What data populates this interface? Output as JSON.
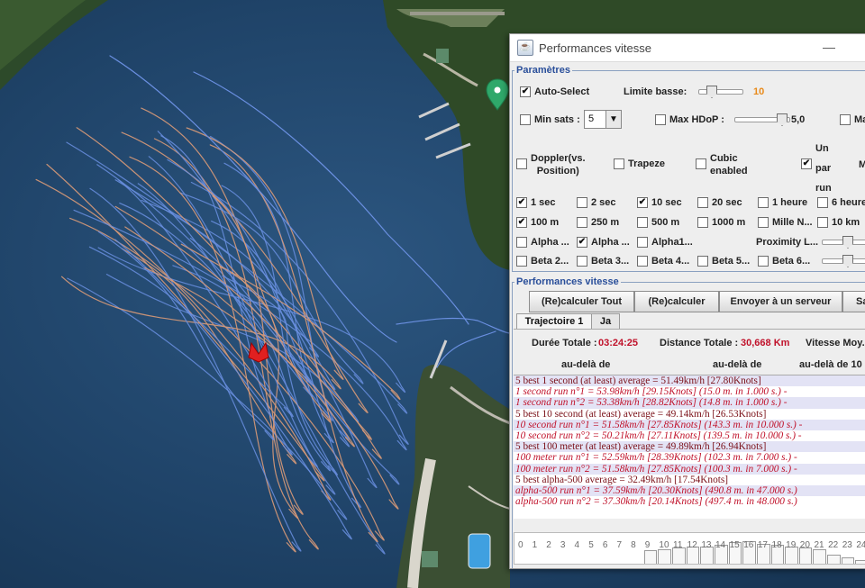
{
  "window": {
    "title": "Performances vitesse",
    "icon": "java-cup-icon"
  },
  "params": {
    "legend": "Paramètres",
    "auto_select": {
      "label": "Auto-Select",
      "checked": true
    },
    "limite_basse": {
      "label": "Limite basse:",
      "value": "10"
    },
    "min_sats": {
      "label": "Min sats :",
      "value": "5",
      "checked": false
    },
    "max_hdop": {
      "label": "Max HDoP :",
      "value": "5,0",
      "checked": false
    },
    "ma": {
      "label": "Ma"
    },
    "doppler": {
      "label_line1": "Doppler(vs.",
      "label_line2": "Position)",
      "checked": false
    },
    "trapeze": {
      "label": "Trapeze",
      "checked": false
    },
    "cubic": {
      "label_line1": "Cubic",
      "label_line2": "enabled",
      "checked": false
    },
    "un_par_run": {
      "label_line1": "Un",
      "label_line2": "par",
      "label_line3": "run",
      "checked": true
    },
    "m_label": "M",
    "durations": [
      {
        "label": "1 sec",
        "checked": true
      },
      {
        "label": "2 sec",
        "checked": false
      },
      {
        "label": "10 sec",
        "checked": true
      },
      {
        "label": "20 sec",
        "checked": false
      },
      {
        "label": "1 heure",
        "checked": false
      },
      {
        "label": "6 heure",
        "checked": false
      }
    ],
    "distances": [
      {
        "label": "100 m",
        "checked": true
      },
      {
        "label": "250 m",
        "checked": false
      },
      {
        "label": "500 m",
        "checked": false
      },
      {
        "label": "1000 m",
        "checked": false
      },
      {
        "label": "Mille N...",
        "checked": false
      },
      {
        "label": "10 km",
        "checked": false
      }
    ],
    "alphas": [
      {
        "label": "Alpha ...",
        "checked": false
      },
      {
        "label": "Alpha ...",
        "checked": true
      },
      {
        "label": "Alpha1...",
        "checked": false
      }
    ],
    "proximity": {
      "label": "Proximity L..."
    },
    "betas": [
      {
        "label": "Beta 2...",
        "checked": false
      },
      {
        "label": "Beta 3...",
        "checked": false
      },
      {
        "label": "Beta 4...",
        "checked": false
      },
      {
        "label": "Beta 5...",
        "checked": false
      },
      {
        "label": "Beta 6...",
        "checked": false
      }
    ]
  },
  "perf": {
    "legend": "Performances vitesse",
    "buttons": {
      "recalc_all": "(Re)calculer Tout",
      "recalc": "(Re)calculer",
      "send": "Envoyer à un serveur",
      "save": "Sa"
    },
    "tabs": [
      "Trajectoire 1",
      "Ja"
    ],
    "duree_label": "Durée Totale :",
    "duree_value": "03:24:25",
    "distance_label": "Distance Totale :",
    "distance_value": "30,668 Km",
    "vitesse_label": "Vitesse Moy.",
    "col1": "au-delà de",
    "col2": "au-delà de",
    "col3": "au-delà de 10"
  },
  "results": [
    {
      "text": "5 best 1 second (at least) average = 51.49km/h [27.80Knots]",
      "kind": "hdr"
    },
    {
      "text": "1 second run n°1 = 53.98km/h [29.15Knots] (15.0 m. in 1.000 s.) -",
      "kind": "red"
    },
    {
      "text": "1 second run n°2 = 53.38km/h [28.82Knots] (14.8 m. in 1.000 s.) -",
      "kind": "red"
    },
    {
      "text": "5 best 10 second (at least) average = 49.14km/h [26.53Knots]",
      "kind": "hdr"
    },
    {
      "text": "10 second run n°1 = 51.58km/h [27.85Knots] (143.3 m. in 10.000 s.) -",
      "kind": "red"
    },
    {
      "text": "10 second run n°2 = 50.21km/h [27.11Knots] (139.5 m. in 10.000 s.) -",
      "kind": "red"
    },
    {
      "text": "5 best 100 meter (at least) average = 49.89km/h [26.94Knots]",
      "kind": "hdr"
    },
    {
      "text": "100 meter run n°1 = 52.59km/h [28.39Knots] (102.3 m. in 7.000 s.) -",
      "kind": "red"
    },
    {
      "text": "100 meter run n°2 = 51.58km/h [27.85Knots] (100.3 m. in 7.000 s.) -",
      "kind": "red"
    },
    {
      "text": "5 best alpha-500 average = 32.49km/h [17.54Knots]",
      "kind": "hdr"
    },
    {
      "text": "alpha-500 run n°1 = 37.59km/h [20.30Knots] (490.8 m. in 47.000 s.)",
      "kind": "red"
    },
    {
      "text": "alpha-500 run n°2 = 37.30km/h [20.14Knots] (497.4 m. in 48.000 s.)",
      "kind": "red"
    }
  ],
  "timeline": {
    "hours": [
      "0",
      "1",
      "2",
      "3",
      "4",
      "5",
      "6",
      "7",
      "8",
      "9",
      "10",
      "11",
      "12",
      "13",
      "14",
      "15",
      "16",
      "17",
      "18",
      "19",
      "20",
      "21",
      "22",
      "23",
      "24"
    ],
    "activity": [
      0,
      0,
      0,
      0,
      0,
      0,
      0,
      0,
      0,
      0.45,
      0.5,
      0.55,
      0.6,
      0.6,
      0.65,
      0.75,
      0.8,
      0.7,
      0.65,
      0.6,
      0.55,
      0.5,
      0.3,
      0.2,
      0.1
    ]
  }
}
